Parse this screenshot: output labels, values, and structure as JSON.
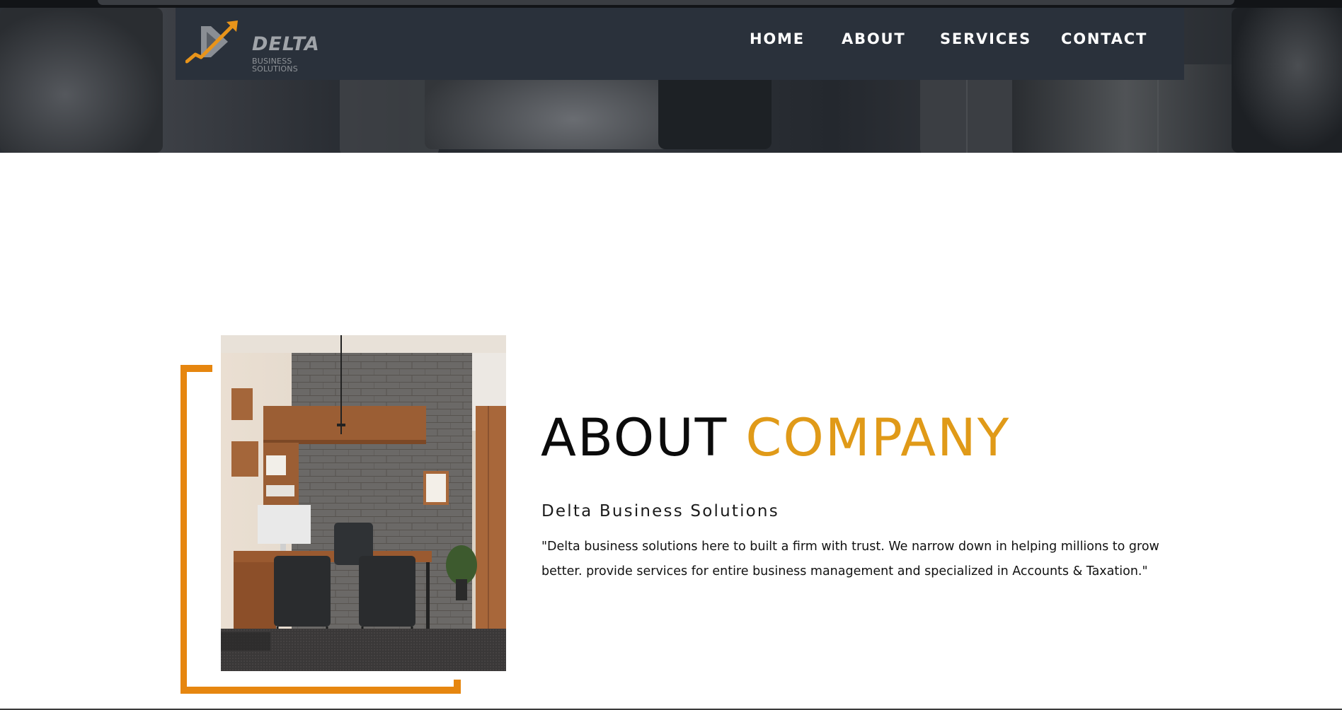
{
  "brand": {
    "name": "DELTA",
    "tagline": "BUSINESS SOLUTIONS",
    "accent_color": "#e6860f",
    "nav_bg": "#2a313b"
  },
  "nav": {
    "items": [
      {
        "label": "HOME"
      },
      {
        "label": "ABOUT"
      },
      {
        "label": "SERVICES"
      },
      {
        "label": "CONTACT"
      }
    ]
  },
  "about": {
    "title_part1": "ABOUT ",
    "title_part2": "COMPANY",
    "title_part2_color": "#e09a18",
    "subtitle": "Delta Business Solutions",
    "description": "\"Delta business solutions here to built a firm with trust. We narrow down in helping millions to grow better. provide services for entire business management and specialized in Accounts & Taxation.\"",
    "image": "office-interior-photo"
  }
}
